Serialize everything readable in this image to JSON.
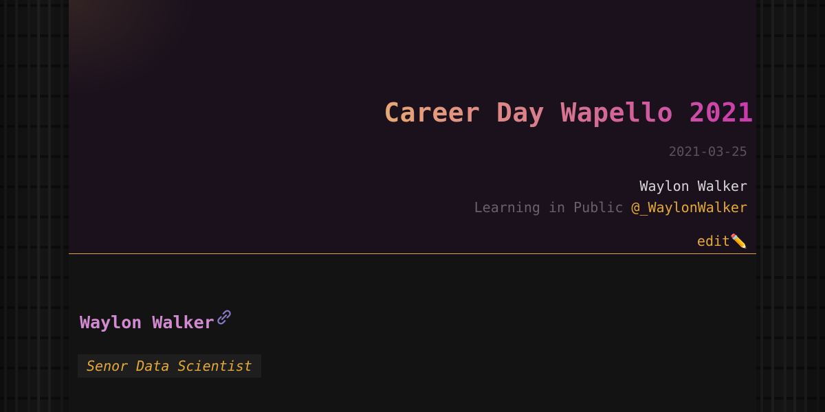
{
  "post": {
    "title": "Career Day Wapello 2021",
    "date": "2021-03-25",
    "author": "Waylon Walker",
    "tagline_prefix": "Learning in Public",
    "handle": "@_WaylonWalker",
    "edit_label": "edit✏️"
  },
  "content": {
    "heading": "Waylon Walker",
    "role": "Senor Data Scientist"
  },
  "icons": {
    "heading_anchor": "link-icon",
    "edit": "pencil-icon"
  },
  "colors": {
    "accent": "#e3a934",
    "heading": "#d28ad0",
    "title_gradient": [
      "#e8a875",
      "#d77a8e",
      "#c93aae"
    ],
    "header_bg": "#1b111c",
    "page_bg": "#131313"
  }
}
